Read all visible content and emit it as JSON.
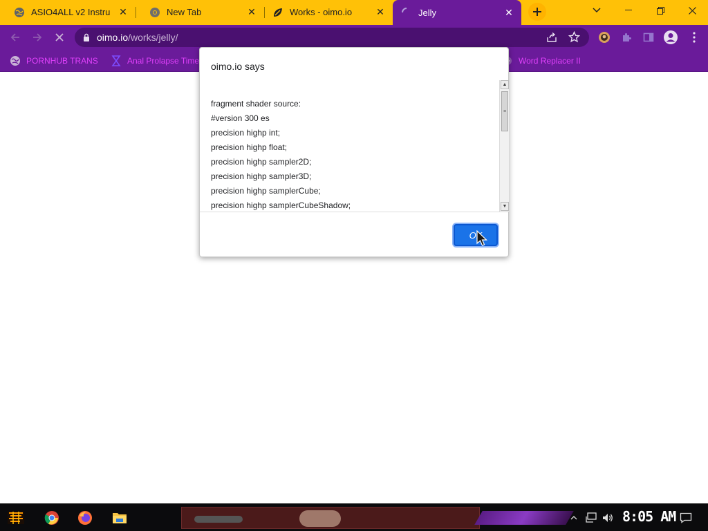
{
  "tabs": [
    {
      "title": "ASIO4ALL v2 Instru",
      "favicon": "globe-icon",
      "active": false
    },
    {
      "title": "New Tab",
      "favicon": "chrome-icon",
      "active": false
    },
    {
      "title": "Works - oimo.io",
      "favicon": "oimo-leaf-icon",
      "active": false
    },
    {
      "title": "Jelly",
      "favicon": "loading-spinner-icon",
      "active": true
    }
  ],
  "address": {
    "host": "oimo.io",
    "path": "/works/jelly/"
  },
  "bookmarks": [
    {
      "label": "PORNHUB TRANS",
      "icon": "globe-icon"
    },
    {
      "label": "Anal Prolapse Time",
      "icon": "bookmark-icon"
    },
    {
      "label": "Word Replacer II",
      "icon": "extension-icon"
    }
  ],
  "dialog": {
    "title": "oimo.io says",
    "lines": [
      "fragment shader source:",
      "#version 300 es",
      "precision highp int;",
      "precision highp float;",
      "precision highp sampler2D;",
      "precision highp sampler3D;",
      "precision highp samplerCube;",
      "precision highp samplerCubeShadow;"
    ],
    "ok_label": "OK"
  },
  "taskbar": {
    "clock": "8:05 AM",
    "apps": [
      "start-button",
      "chrome-icon",
      "firefox-icon",
      "file-explorer-icon"
    ]
  },
  "colors": {
    "tab_strip": "#ffc107",
    "toolbar": "#6a1b9a",
    "bookmark_text": "#e040fb",
    "ok_button": "#1a73e8"
  }
}
